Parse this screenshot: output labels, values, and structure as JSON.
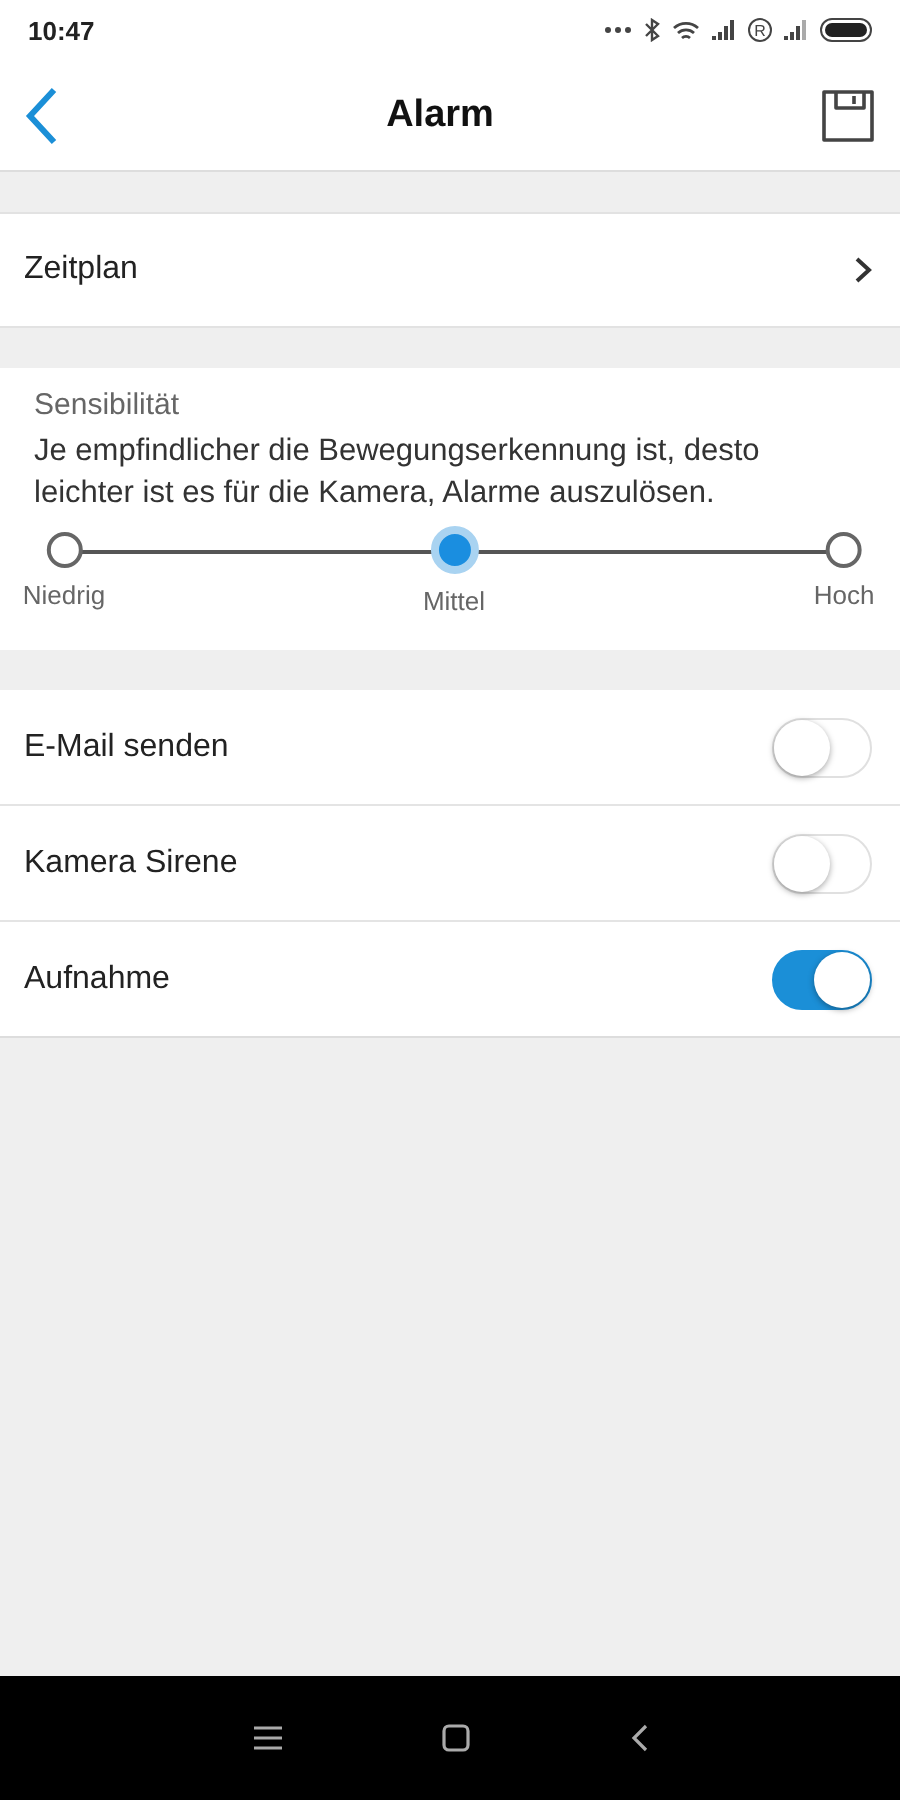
{
  "status_bar": {
    "time": "10:47",
    "roaming_mark": "R"
  },
  "header": {
    "title": "Alarm"
  },
  "schedule": {
    "label": "Zeitplan"
  },
  "sensitivity": {
    "title": "Sensibilität",
    "description": "Je empfindlicher die Bewegungserkennung ist, desto leichter ist es für die Kamera, Alarme auszulösen.",
    "options": [
      {
        "label": "Niedrig",
        "selected": false
      },
      {
        "label": "Mittel",
        "selected": true
      },
      {
        "label": "Hoch",
        "selected": false
      }
    ]
  },
  "toggles": [
    {
      "label": "E-Mail senden",
      "on": false
    },
    {
      "label": "Kamera Sirene",
      "on": false
    },
    {
      "label": "Aufnahme",
      "on": true
    }
  ]
}
